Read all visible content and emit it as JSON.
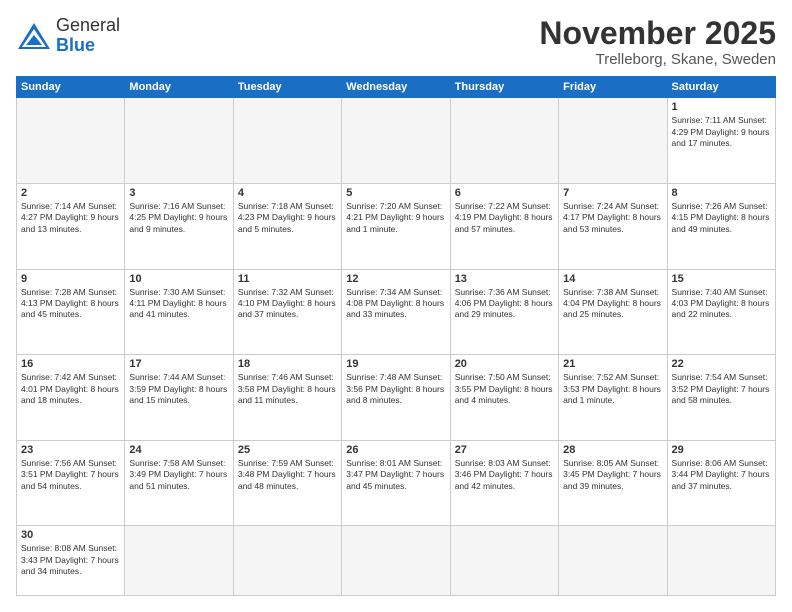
{
  "logo": {
    "text_general": "General",
    "text_blue": "Blue"
  },
  "header": {
    "month": "November 2025",
    "location": "Trelleborg, Skane, Sweden"
  },
  "weekdays": [
    "Sunday",
    "Monday",
    "Tuesday",
    "Wednesday",
    "Thursday",
    "Friday",
    "Saturday"
  ],
  "weeks": [
    [
      {
        "day": "",
        "info": ""
      },
      {
        "day": "",
        "info": ""
      },
      {
        "day": "",
        "info": ""
      },
      {
        "day": "",
        "info": ""
      },
      {
        "day": "",
        "info": ""
      },
      {
        "day": "",
        "info": ""
      },
      {
        "day": "1",
        "info": "Sunrise: 7:11 AM\nSunset: 4:29 PM\nDaylight: 9 hours\nand 17 minutes."
      }
    ],
    [
      {
        "day": "2",
        "info": "Sunrise: 7:14 AM\nSunset: 4:27 PM\nDaylight: 9 hours\nand 13 minutes."
      },
      {
        "day": "3",
        "info": "Sunrise: 7:16 AM\nSunset: 4:25 PM\nDaylight: 9 hours\nand 9 minutes."
      },
      {
        "day": "4",
        "info": "Sunrise: 7:18 AM\nSunset: 4:23 PM\nDaylight: 9 hours\nand 5 minutes."
      },
      {
        "day": "5",
        "info": "Sunrise: 7:20 AM\nSunset: 4:21 PM\nDaylight: 9 hours\nand 1 minute."
      },
      {
        "day": "6",
        "info": "Sunrise: 7:22 AM\nSunset: 4:19 PM\nDaylight: 8 hours\nand 57 minutes."
      },
      {
        "day": "7",
        "info": "Sunrise: 7:24 AM\nSunset: 4:17 PM\nDaylight: 8 hours\nand 53 minutes."
      },
      {
        "day": "8",
        "info": "Sunrise: 7:26 AM\nSunset: 4:15 PM\nDaylight: 8 hours\nand 49 minutes."
      }
    ],
    [
      {
        "day": "9",
        "info": "Sunrise: 7:28 AM\nSunset: 4:13 PM\nDaylight: 8 hours\nand 45 minutes."
      },
      {
        "day": "10",
        "info": "Sunrise: 7:30 AM\nSunset: 4:11 PM\nDaylight: 8 hours\nand 41 minutes."
      },
      {
        "day": "11",
        "info": "Sunrise: 7:32 AM\nSunset: 4:10 PM\nDaylight: 8 hours\nand 37 minutes."
      },
      {
        "day": "12",
        "info": "Sunrise: 7:34 AM\nSunset: 4:08 PM\nDaylight: 8 hours\nand 33 minutes."
      },
      {
        "day": "13",
        "info": "Sunrise: 7:36 AM\nSunset: 4:06 PM\nDaylight: 8 hours\nand 29 minutes."
      },
      {
        "day": "14",
        "info": "Sunrise: 7:38 AM\nSunset: 4:04 PM\nDaylight: 8 hours\nand 25 minutes."
      },
      {
        "day": "15",
        "info": "Sunrise: 7:40 AM\nSunset: 4:03 PM\nDaylight: 8 hours\nand 22 minutes."
      }
    ],
    [
      {
        "day": "16",
        "info": "Sunrise: 7:42 AM\nSunset: 4:01 PM\nDaylight: 8 hours\nand 18 minutes."
      },
      {
        "day": "17",
        "info": "Sunrise: 7:44 AM\nSunset: 3:59 PM\nDaylight: 8 hours\nand 15 minutes."
      },
      {
        "day": "18",
        "info": "Sunrise: 7:46 AM\nSunset: 3:58 PM\nDaylight: 8 hours\nand 11 minutes."
      },
      {
        "day": "19",
        "info": "Sunrise: 7:48 AM\nSunset: 3:56 PM\nDaylight: 8 hours\nand 8 minutes."
      },
      {
        "day": "20",
        "info": "Sunrise: 7:50 AM\nSunset: 3:55 PM\nDaylight: 8 hours\nand 4 minutes."
      },
      {
        "day": "21",
        "info": "Sunrise: 7:52 AM\nSunset: 3:53 PM\nDaylight: 8 hours\nand 1 minute."
      },
      {
        "day": "22",
        "info": "Sunrise: 7:54 AM\nSunset: 3:52 PM\nDaylight: 7 hours\nand 58 minutes."
      }
    ],
    [
      {
        "day": "23",
        "info": "Sunrise: 7:56 AM\nSunset: 3:51 PM\nDaylight: 7 hours\nand 54 minutes."
      },
      {
        "day": "24",
        "info": "Sunrise: 7:58 AM\nSunset: 3:49 PM\nDaylight: 7 hours\nand 51 minutes."
      },
      {
        "day": "25",
        "info": "Sunrise: 7:59 AM\nSunset: 3:48 PM\nDaylight: 7 hours\nand 48 minutes."
      },
      {
        "day": "26",
        "info": "Sunrise: 8:01 AM\nSunset: 3:47 PM\nDaylight: 7 hours\nand 45 minutes."
      },
      {
        "day": "27",
        "info": "Sunrise: 8:03 AM\nSunset: 3:46 PM\nDaylight: 7 hours\nand 42 minutes."
      },
      {
        "day": "28",
        "info": "Sunrise: 8:05 AM\nSunset: 3:45 PM\nDaylight: 7 hours\nand 39 minutes."
      },
      {
        "day": "29",
        "info": "Sunrise: 8:06 AM\nSunset: 3:44 PM\nDaylight: 7 hours\nand 37 minutes."
      }
    ],
    [
      {
        "day": "30",
        "info": "Sunrise: 8:08 AM\nSunset: 3:43 PM\nDaylight: 7 hours\nand 34 minutes."
      },
      {
        "day": "",
        "info": ""
      },
      {
        "day": "",
        "info": ""
      },
      {
        "day": "",
        "info": ""
      },
      {
        "day": "",
        "info": ""
      },
      {
        "day": "",
        "info": ""
      },
      {
        "day": "",
        "info": ""
      }
    ]
  ]
}
